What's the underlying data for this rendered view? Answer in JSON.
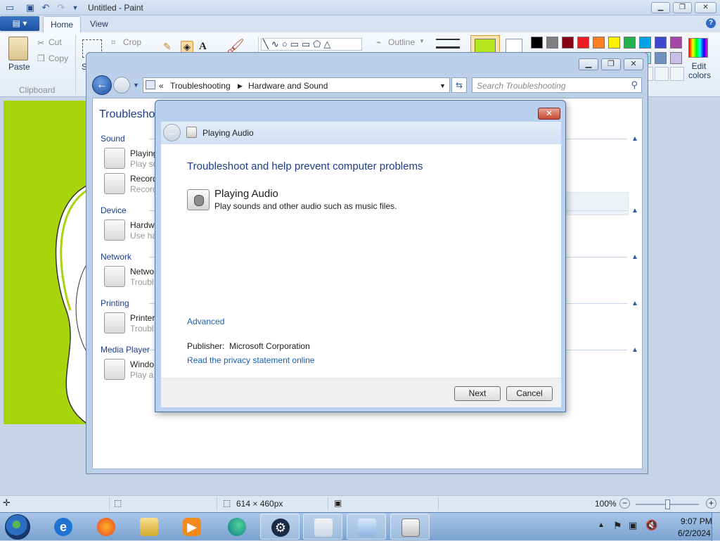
{
  "paint": {
    "title": "Untitled - Paint",
    "file_menu_glyph": "▤ ▾",
    "tabs": [
      {
        "label": "Home"
      },
      {
        "label": "View"
      }
    ],
    "clipboard": {
      "paste": "Paste",
      "cut": "Cut",
      "copy": "Copy",
      "group": "Clipboard"
    },
    "image": {
      "crop": "Crop",
      "select_letter": "S"
    },
    "shapes": {
      "outline": "Outline"
    },
    "edit_colors": "Edit colors",
    "palette": [
      "#000000",
      "#7f7f7f",
      "#880015",
      "#ed1c24",
      "#ff7f27",
      "#fff200",
      "#22b14c",
      "#00a2e8",
      "#3f48cc",
      "#a349a4",
      "#ffffff",
      "#c3c3c3",
      "#b97a57",
      "#ffaec9",
      "#ffc90e",
      "#efe4b0",
      "#b5e61d",
      "#99d9ea",
      "#7092be",
      "#c8bfe7"
    ],
    "color1": "#b5e61d",
    "canvas_color": "#a8d40b",
    "status": {
      "dimensions": "614 × 460px",
      "zoom": "100%"
    }
  },
  "explorer": {
    "address": {
      "prefix": "«",
      "crumb1": "Troubleshooting",
      "crumb2": "Hardware and Sound"
    },
    "search_placeholder": "Search Troubleshooting",
    "heading": "Troublesho",
    "categories": [
      {
        "label": "Sound",
        "items": [
          {
            "title": "Playing",
            "sub": "Play so"
          },
          {
            "title": "Record",
            "sub": "Record"
          }
        ]
      },
      {
        "label": "Device",
        "items": [
          {
            "title": "Hardw",
            "sub": "Use ha"
          }
        ]
      },
      {
        "label": "Network",
        "items": [
          {
            "title": "Netwo",
            "sub": "Troubl"
          }
        ]
      },
      {
        "label": "Printing",
        "items": [
          {
            "title": "Printer",
            "sub": "Troubl"
          }
        ]
      },
      {
        "label": "Media Player",
        "items": [
          {
            "title": "Windo",
            "sub": "Play a"
          }
        ]
      }
    ]
  },
  "dialog": {
    "close_glyph": "✕",
    "nav_title": "Playing Audio",
    "heading": "Troubleshoot and help prevent computer problems",
    "item_title": "Playing Audio",
    "item_desc": "Play sounds and other audio such as music files.",
    "advanced": "Advanced",
    "publisher_label": "Publisher:",
    "publisher_value": "Microsoft Corporation",
    "privacy_link": "Read the privacy statement online",
    "next": "Next",
    "cancel": "Cancel"
  },
  "taskbar": {
    "time": "9:07 PM",
    "date": "6/2/2024",
    "apps": [
      "internet-explorer",
      "firefox",
      "file-explorer",
      "media-player",
      "edge",
      "steam",
      "paint",
      "control-panel",
      "troubleshooter"
    ]
  }
}
